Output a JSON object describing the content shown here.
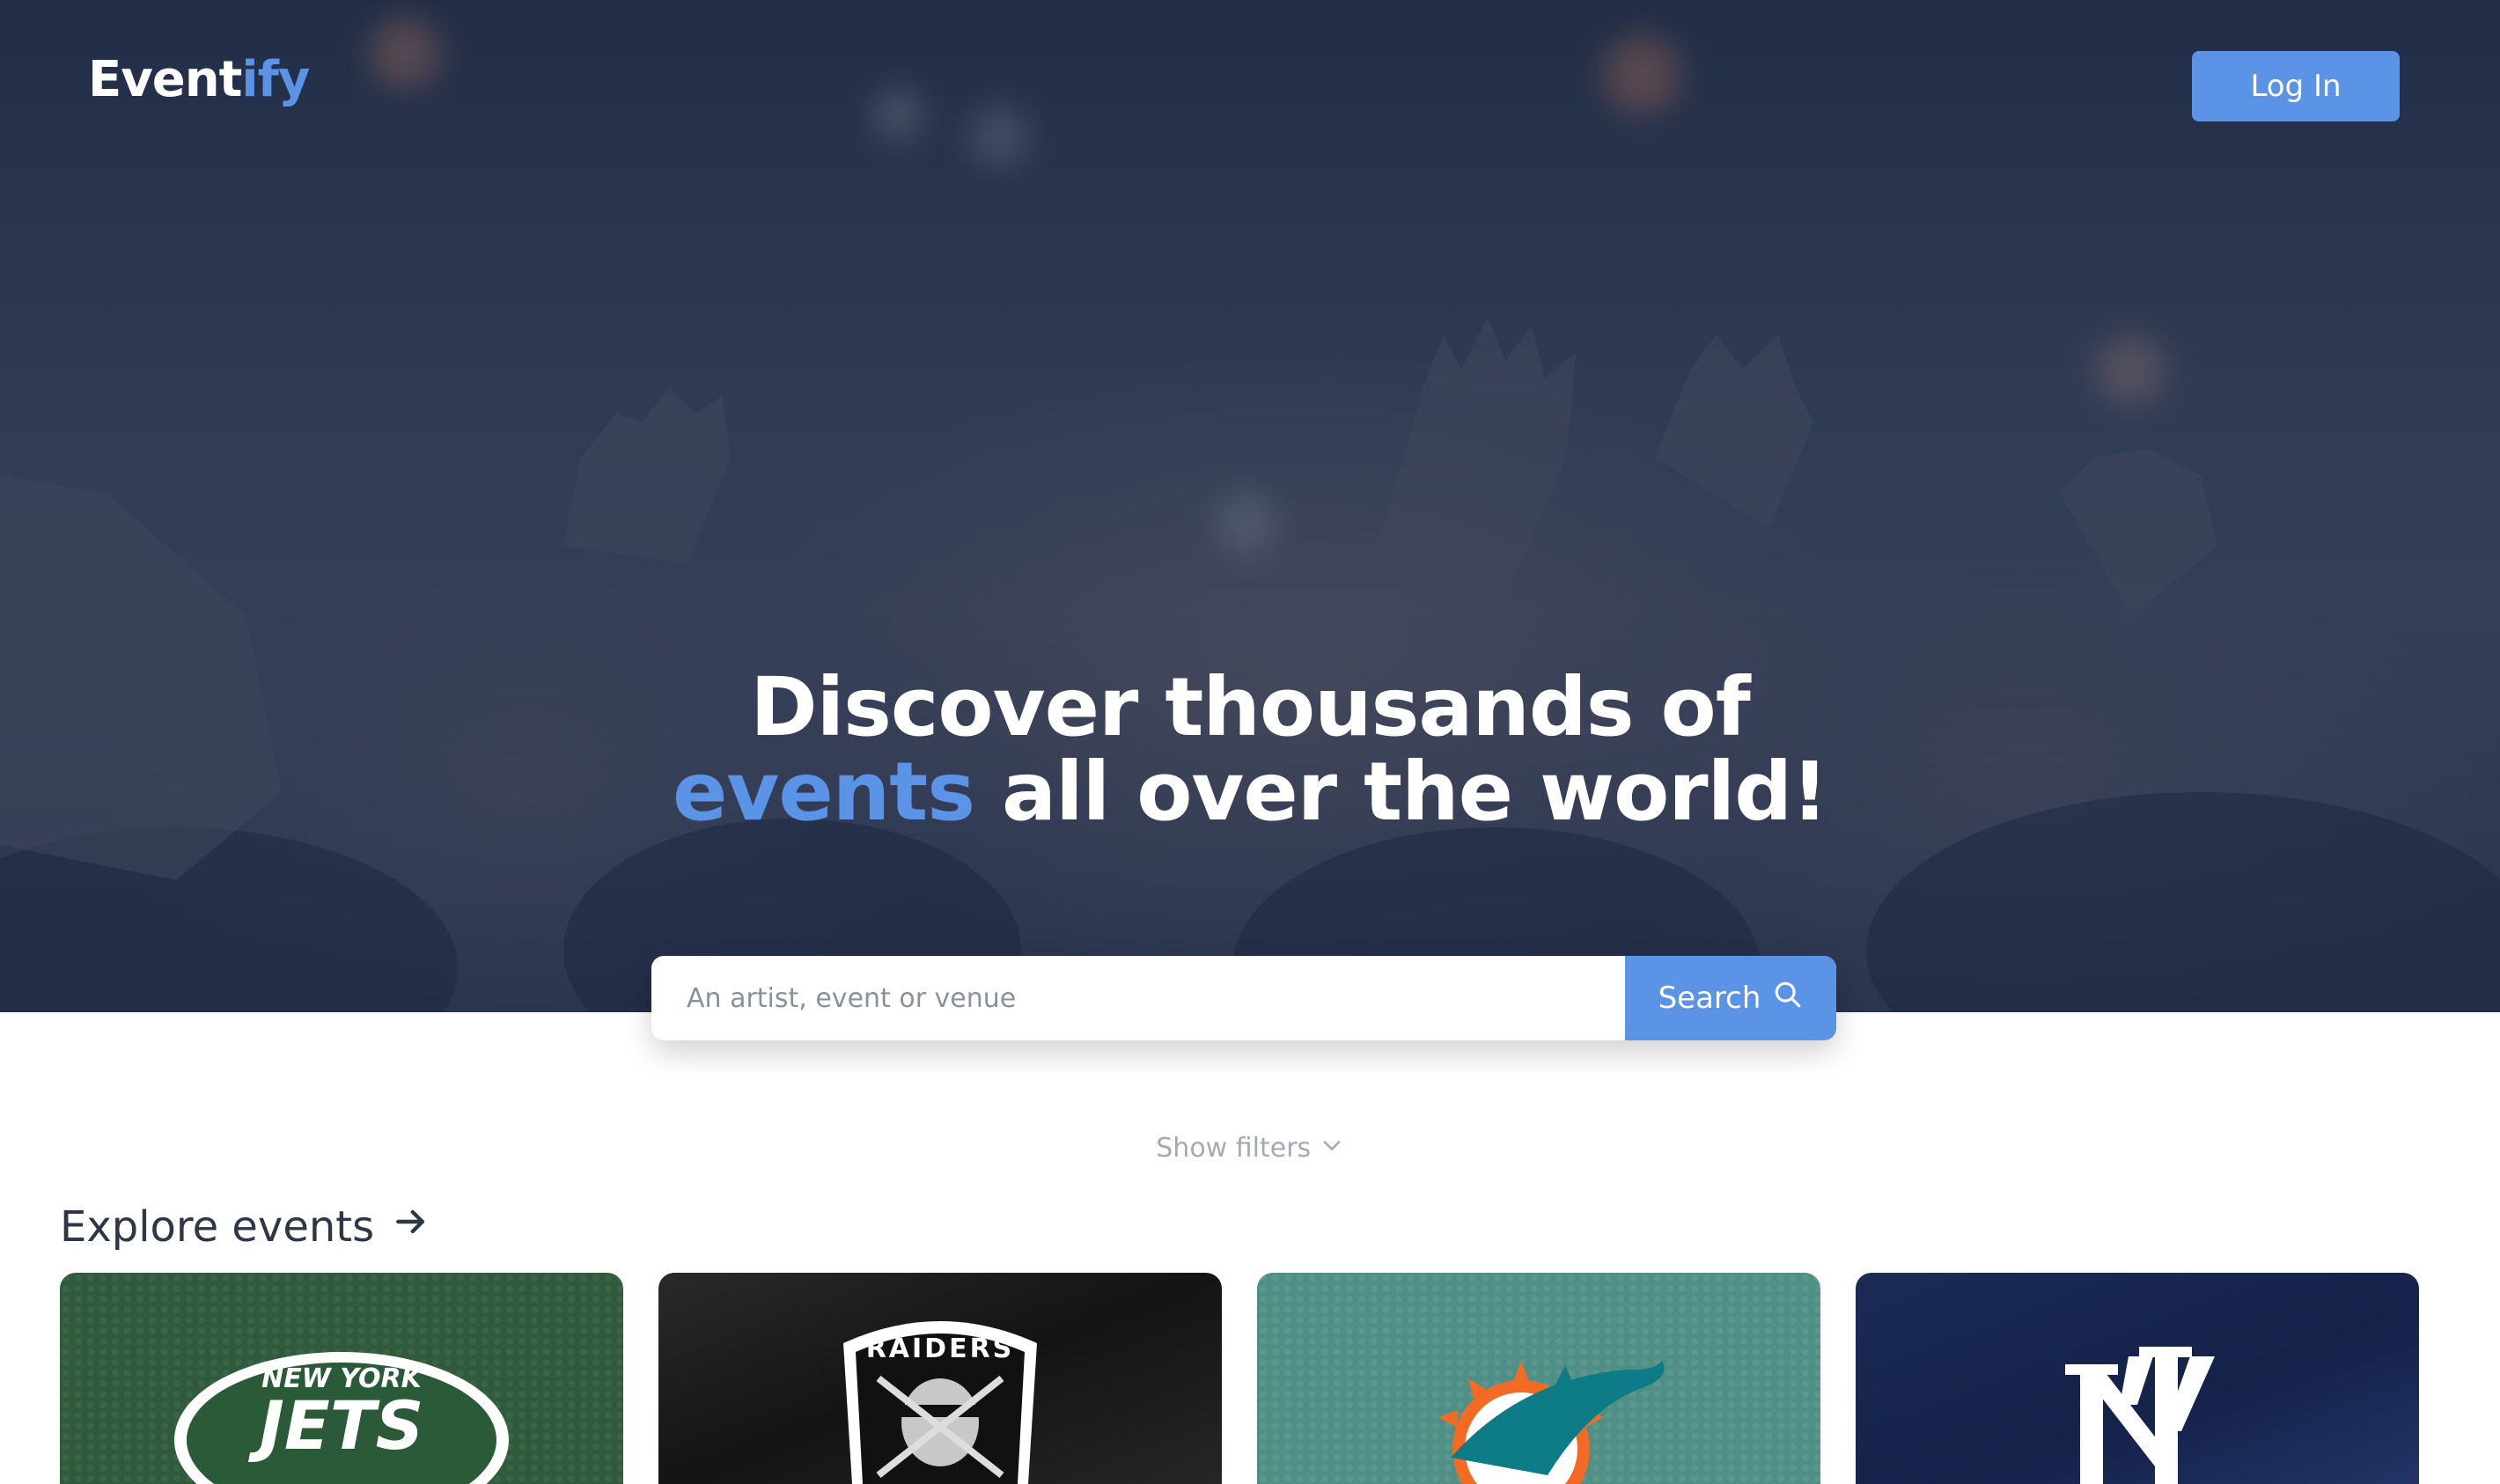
{
  "brand": {
    "logo_main": "Event",
    "logo_accent": "ify",
    "accent_color": "#5b93e6"
  },
  "header": {
    "login_label": "Log In"
  },
  "hero": {
    "headline_line1": "Discover thousands of",
    "headline_accent": "events",
    "headline_rest": " all over the world!"
  },
  "search": {
    "placeholder": "An artist, event or venue",
    "button_label": "Search",
    "button_icon": "search-icon"
  },
  "filters": {
    "toggle_label": "Show filters",
    "toggle_icon": "chevron-down-icon"
  },
  "explore": {
    "title": "Explore events",
    "title_icon": "arrow-right-icon",
    "cards": [
      {
        "team_text_1": "NEW YORK",
        "team_text_2": "JETS",
        "bg_color": "#2f5a3c"
      },
      {
        "team_text_1": "RAIDERS",
        "bg_color": "#1c1c1c"
      },
      {
        "bg_color": "#4f8f86"
      },
      {
        "bg_color": "#16244a"
      }
    ]
  }
}
